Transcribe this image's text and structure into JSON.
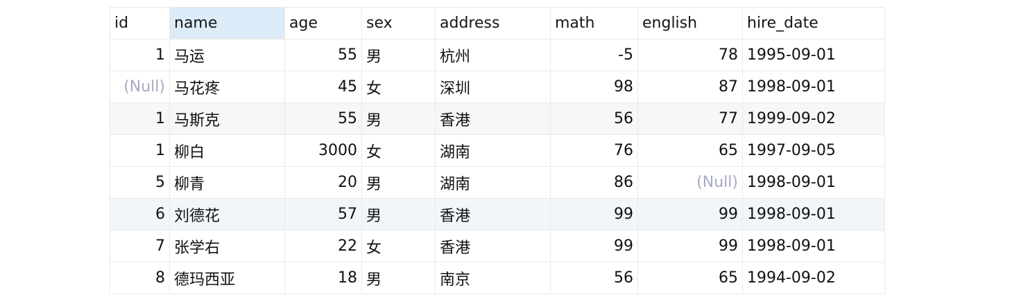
{
  "table": {
    "columns": [
      {
        "key": "id",
        "label": "id",
        "align": "right"
      },
      {
        "key": "name",
        "label": "name",
        "align": "left"
      },
      {
        "key": "age",
        "label": "age",
        "align": "right"
      },
      {
        "key": "sex",
        "label": "sex",
        "align": "left"
      },
      {
        "key": "address",
        "label": "address",
        "align": "left"
      },
      {
        "key": "math",
        "label": "math",
        "align": "right"
      },
      {
        "key": "english",
        "label": "english",
        "align": "right"
      },
      {
        "key": "hire_date",
        "label": "hire_date",
        "align": "left"
      }
    ],
    "highlighted_column": "name",
    "null_text": "(Null)",
    "rows": [
      {
        "style": "plain",
        "cells": [
          "1",
          "马运",
          "55",
          "男",
          "杭州",
          "-5",
          "78",
          "1995-09-01"
        ]
      },
      {
        "style": "plain",
        "cells": [
          "(Null)",
          "马花疼",
          "45",
          "女",
          "深圳",
          "98",
          "87",
          "1998-09-01"
        ]
      },
      {
        "style": "alt",
        "cells": [
          "1",
          "马斯克",
          "55",
          "男",
          "香港",
          "56",
          "77",
          "1999-09-02"
        ]
      },
      {
        "style": "plain",
        "cells": [
          "1",
          "柳白",
          "3000",
          "女",
          "湖南",
          "76",
          "65",
          "1997-09-05"
        ]
      },
      {
        "style": "plain",
        "cells": [
          "5",
          "柳青",
          "20",
          "男",
          "湖南",
          "86",
          "(Null)",
          "1998-09-01"
        ]
      },
      {
        "style": "hl",
        "cells": [
          "6",
          "刘德花",
          "57",
          "男",
          "香港",
          "99",
          "99",
          "1998-09-01"
        ]
      },
      {
        "style": "plain",
        "cells": [
          "7",
          "张学右",
          "22",
          "女",
          "香港",
          "99",
          "99",
          "1998-09-01"
        ]
      },
      {
        "style": "plain",
        "cells": [
          "8",
          "德玛西亚",
          "18",
          "男",
          "南京",
          "56",
          "65",
          "1994-09-02"
        ]
      }
    ]
  }
}
